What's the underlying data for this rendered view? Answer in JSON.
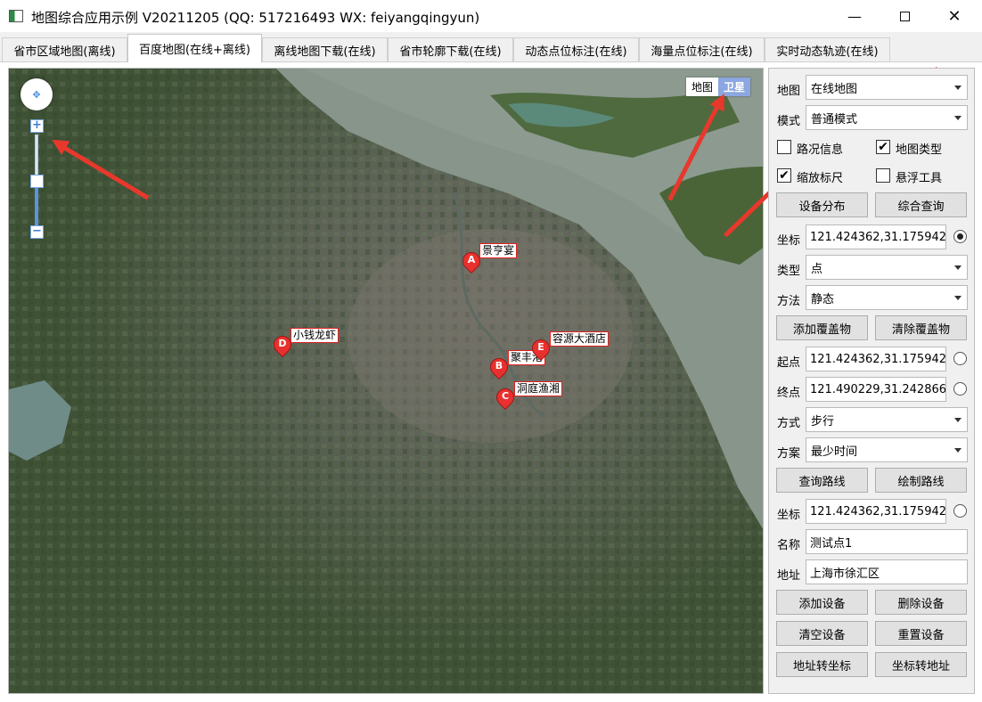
{
  "window": {
    "title": "地图综合应用示例 V20211205 (QQ: 517216493 WX: feiyangqingyun)",
    "minimize_icon": "minimize-icon",
    "maximize_icon": "maximize-icon",
    "close_icon": "close-icon"
  },
  "tabs": [
    {
      "label": "省市区域地图(离线)",
      "active": false
    },
    {
      "label": "百度地图(在线+离线)",
      "active": true
    },
    {
      "label": "离线地图下载(在线)",
      "active": false
    },
    {
      "label": "省市轮廓下载(在线)",
      "active": false
    },
    {
      "label": "动态点位标注(在线)",
      "active": false
    },
    {
      "label": "海量点位标注(在线)",
      "active": false
    },
    {
      "label": "实时动态轨迹(在线)",
      "active": false
    }
  ],
  "map": {
    "type_toggle": {
      "map_label": "地图",
      "satellite_label": "卫星",
      "selected": "卫星"
    },
    "zoom": {
      "in_label": "+",
      "out_label": "−",
      "level_fraction": 0.45
    },
    "markers": [
      {
        "letter": "A",
        "label": "景亨宴"
      },
      {
        "letter": "B",
        "label": "聚丰港"
      },
      {
        "letter": "C",
        "label": "洞庭渔湘"
      },
      {
        "letter": "D",
        "label": "小钱龙虾"
      },
      {
        "letter": "E",
        "label": "容源大酒店"
      }
    ],
    "accent_color": "#e8382c"
  },
  "panel": {
    "map_label": "地图",
    "map_value": "在线地图",
    "mode_label": "模式",
    "mode_value": "普通模式",
    "checks": {
      "traffic": {
        "label": "路况信息",
        "checked": false
      },
      "maptype": {
        "label": "地图类型",
        "checked": true
      },
      "scale": {
        "label": "缩放标尺",
        "checked": true
      },
      "float": {
        "label": "悬浮工具",
        "checked": false
      }
    },
    "btn_distribution": "设备分布",
    "btn_query": "综合查询",
    "coord_label": "坐标",
    "coord_value": "121.424362,31.175942",
    "type_label": "类型",
    "type_value": "点",
    "method_label": "方法",
    "method_value": "静态",
    "btn_add_overlay": "添加覆盖物",
    "btn_clear_overlay": "清除覆盖物",
    "start_label": "起点",
    "start_value": "121.424362,31.175942",
    "end_label": "终点",
    "end_value": "121.490229,31.242866",
    "way_label": "方式",
    "way_value": "步行",
    "plan_label": "方案",
    "plan_value": "最少时间",
    "btn_query_route": "查询路线",
    "btn_draw_route": "绘制路线",
    "coord2_label": "坐标",
    "coord2_value": "121.424362,31.175942",
    "name_label": "名称",
    "name_value": "测试点1",
    "addr_label": "地址",
    "addr_value": "上海市徐汇区",
    "btn_add_device": "添加设备",
    "btn_del_device": "删除设备",
    "btn_clear_device": "清空设备",
    "btn_reset_device": "重置设备",
    "btn_addr2coord": "地址转坐标",
    "btn_coord2addr": "坐标转地址"
  }
}
